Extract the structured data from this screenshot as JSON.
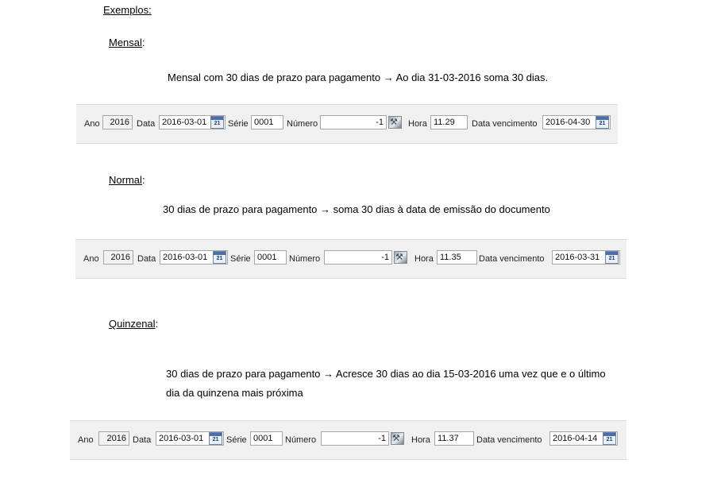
{
  "heading": "Exemplos:",
  "sections": [
    {
      "title": "Mensal",
      "description": "Mensal com 30 dias de prazo para pagamento → Ao dia 31-03-2016 soma 30 dias.",
      "form": {
        "ano": "2016",
        "data": "2016-03-01",
        "serie": "0001",
        "numero": "-1",
        "hora": "11.29",
        "vencimento": "2016-04-30"
      }
    },
    {
      "title": "Normal",
      "description": "30 dias de prazo para pagamento → soma 30 dias à data de emissão do documento",
      "form": {
        "ano": "2016",
        "data": "2016-03-01",
        "serie": "0001",
        "numero": "-1",
        "hora": "11.35",
        "vencimento": "2016-03-31"
      }
    },
    {
      "title": "Quinzenal",
      "description": "30 dias de prazo para pagamento → Acresce 30 dias ao dia 15-03-2016 uma vez que e o último dia da quinzena mais próxima",
      "form": {
        "ano": "2016",
        "data": "2016-03-01",
        "serie": "0001",
        "numero": "-1",
        "hora": "11.37",
        "vencimento": "2016-04-14"
      }
    }
  ],
  "labels": {
    "ano": "Ano",
    "data": "Data",
    "serie": "Série",
    "numero": "Número",
    "hora": "Hora",
    "vencimento": "Data vencimento",
    "colon": ":",
    "calendar_glyph": "21",
    "picture_glyph": "⚒"
  },
  "icons": {
    "calendar": "calendar-icon",
    "numbering": "numbering-picker-icon"
  }
}
